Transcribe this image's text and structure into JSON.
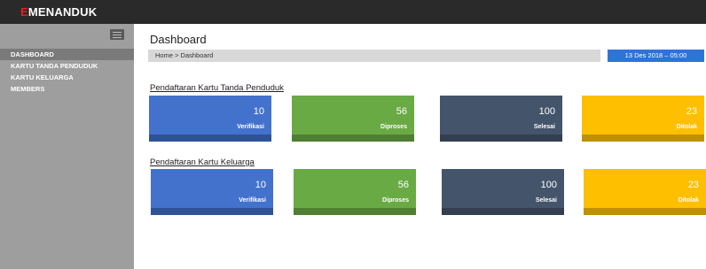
{
  "brand": {
    "prefix": "E",
    "name": "MENANDUK"
  },
  "sidebar": {
    "items": [
      {
        "label": "DASHBOARD"
      },
      {
        "label": "KARTU TANDA PENDUDUK"
      },
      {
        "label": "KARTU KELUARGA"
      },
      {
        "label": "MEMBERS"
      }
    ]
  },
  "header": {
    "title": "Dashboard",
    "breadcrumb": "Home > Dashboard",
    "datetime": "13 Des 2018 – 05:00"
  },
  "sections": [
    {
      "title": "Pendaftaran Kartu Tanda Penduduk",
      "cards": [
        {
          "value": "10",
          "label": "Verifikasi",
          "color": "#4372cc",
          "foot": "#2d5396"
        },
        {
          "value": "56",
          "label": "Diproses",
          "color": "#6aaa45",
          "foot": "#4f7f33"
        },
        {
          "value": "100",
          "label": "Selesai",
          "color": "#44546a",
          "foot": "#333f50"
        },
        {
          "value": "23",
          "label": "Ditolak",
          "color": "#fdbf00",
          "foot": "#bf9000"
        }
      ]
    },
    {
      "title": "Pendaftaran Kartu Keluarga",
      "cards": [
        {
          "value": "10",
          "label": "Verifikasi",
          "color": "#4372cc",
          "foot": "#2d5396"
        },
        {
          "value": "56",
          "label": "Diproses",
          "color": "#6aaa45",
          "foot": "#4f7f33"
        },
        {
          "value": "100",
          "label": "Selesai",
          "color": "#44546a",
          "foot": "#333f50"
        },
        {
          "value": "23",
          "label": "Ditolak",
          "color": "#fdbf00",
          "foot": "#bf9000"
        }
      ]
    }
  ]
}
